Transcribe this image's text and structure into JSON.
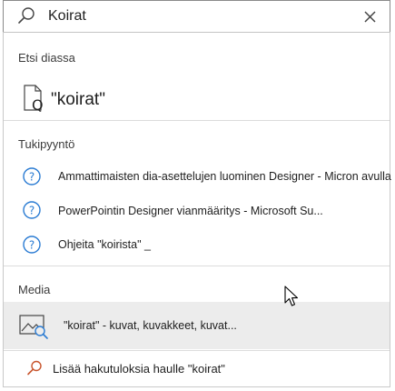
{
  "search": {
    "query": "Koirat"
  },
  "sections": {
    "slide_search": {
      "title": "Etsi diassa",
      "result_label": "\"koirat\""
    },
    "help": {
      "title": "Tukipyyntö",
      "items": [
        {
          "label": "Ammattimaisten dia-asettelujen luominen Designer - Micron avulla"
        },
        {
          "label": "PowerPointin Designer vianmääritys - Microsoft Su..."
        },
        {
          "label": "Ohjeita \"koirista\"  _"
        }
      ]
    },
    "media": {
      "title": "Media",
      "item_label": "\"koirat\" - kuvat, kuvakkeet, kuvat..."
    }
  },
  "footer": {
    "more_results_label": "Lisää hakutuloksia haulle \"koirat\""
  },
  "colors": {
    "help_icon_blue": "#2b7cd3",
    "more_search_icon_red": "#c8552d",
    "hover_bg": "#ececec"
  }
}
